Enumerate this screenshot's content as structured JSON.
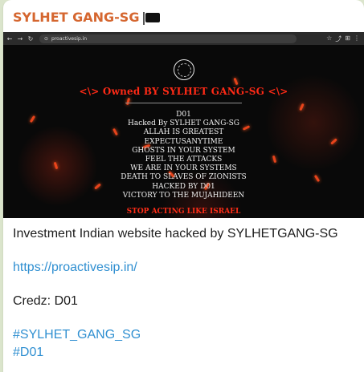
{
  "channel": {
    "name": "SYLHET GANG-SG",
    "flag_icon": "black-flag-icon"
  },
  "browser": {
    "url": "proactivesip.in",
    "icons": {
      "back": "arrow-left-icon",
      "forward": "arrow-right-icon",
      "refresh": "refresh-icon",
      "lock": "lock-icon",
      "star": "star-icon",
      "share": "share-icon",
      "extensions": "puzzle-icon",
      "menu": "more-icon"
    }
  },
  "deface": {
    "headline": "<\\> Owned BY SYLHET GANG-SG <\\>",
    "lines": [
      "D01",
      "Hacked By SYLHET GANG-SG",
      "ALLAH IS GREATEST",
      "EXPECTUSANYTIME",
      "GHOSTS IN YOUR SYSTEM",
      "FEEL THE ATTACKS",
      "WE ARE IN YOUR SYSTEMS",
      "DEATH TO SLAVES OF ZIONISTS",
      "HACKED BY D01",
      "VICTORY TO THE MUJAHIDEEN"
    ],
    "footer": "STOP ACTING LIKE ISRAEL"
  },
  "message": {
    "title": "Investment Indian website hacked by SYLHETGANG-SG",
    "link": "https://proactivesip.in/",
    "credz": "Credz: D01",
    "hashtags": [
      "#SYLHET_GANG_SG",
      "#D01"
    ]
  },
  "colors": {
    "channel_name": "#d5662f",
    "link": "#2f8fd1",
    "deface_red": "#ff2a16",
    "deface_bg": "#090909"
  }
}
